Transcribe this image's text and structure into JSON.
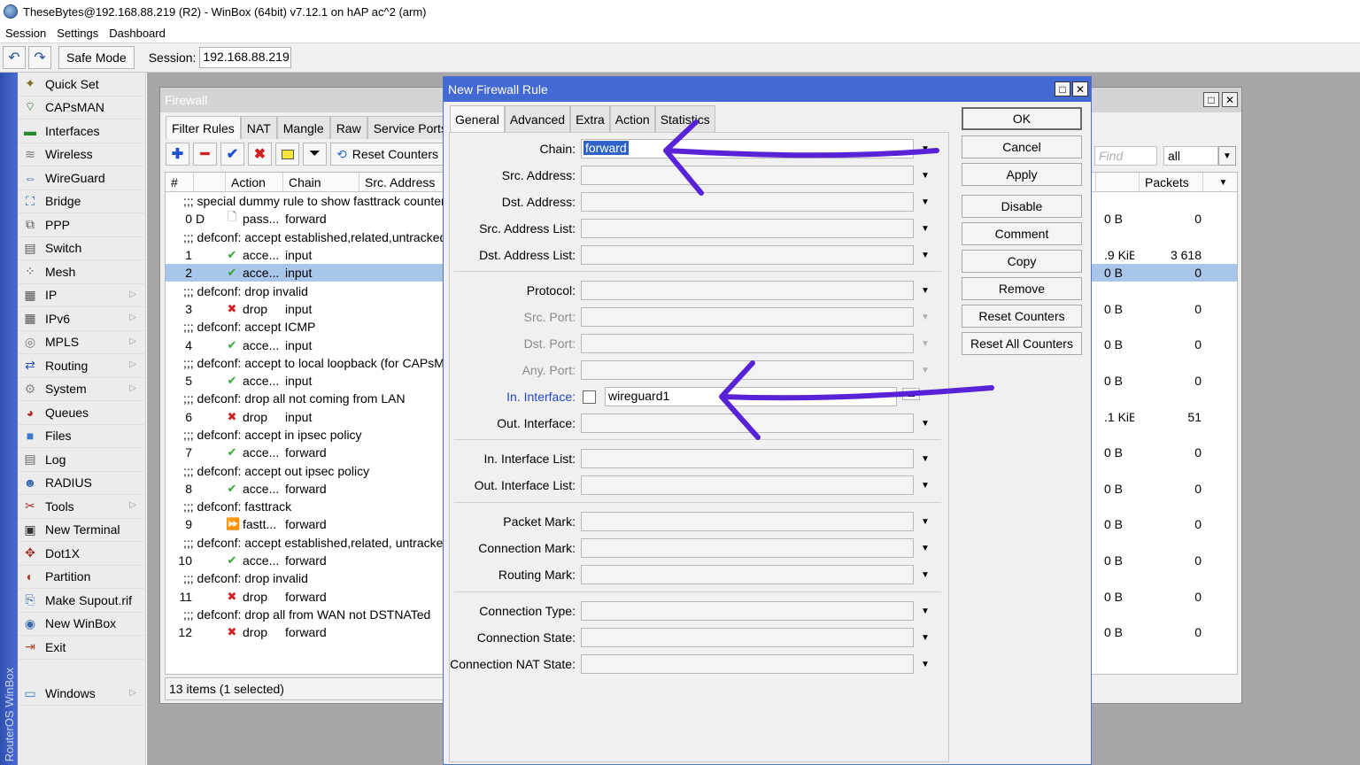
{
  "window_title": "TheseBytes@192.168.88.219 (R2) - WinBox (64bit) v7.12.1 on hAP ac^2 (arm)",
  "menu": [
    "Session",
    "Settings",
    "Dashboard"
  ],
  "toolbar": {
    "safe_mode": "Safe Mode",
    "session_label": "Session:",
    "session_value": "192.168.88.219"
  },
  "vertical_brand": "RouterOS WinBox",
  "sidebar": [
    {
      "label": "Quick Set",
      "icon": "wand-icon",
      "sub": false
    },
    {
      "label": "CAPsMAN",
      "icon": "antenna-icon",
      "sub": false
    },
    {
      "label": "Interfaces",
      "icon": "network-card-icon",
      "sub": false
    },
    {
      "label": "Wireless",
      "icon": "wifi-icon",
      "sub": false
    },
    {
      "label": "WireGuard",
      "icon": "wireguard-icon",
      "sub": false
    },
    {
      "label": "Bridge",
      "icon": "bridge-icon",
      "sub": false
    },
    {
      "label": "PPP",
      "icon": "ppp-icon",
      "sub": false
    },
    {
      "label": "Switch",
      "icon": "switch-icon",
      "sub": false
    },
    {
      "label": "Mesh",
      "icon": "mesh-icon",
      "sub": false
    },
    {
      "label": "IP",
      "icon": "ip-icon",
      "sub": true
    },
    {
      "label": "IPv6",
      "icon": "ipv6-icon",
      "sub": true
    },
    {
      "label": "MPLS",
      "icon": "mpls-icon",
      "sub": true
    },
    {
      "label": "Routing",
      "icon": "routing-icon",
      "sub": true
    },
    {
      "label": "System",
      "icon": "gear-icon",
      "sub": true
    },
    {
      "label": "Queues",
      "icon": "queues-icon",
      "sub": false
    },
    {
      "label": "Files",
      "icon": "folder-icon",
      "sub": false
    },
    {
      "label": "Log",
      "icon": "log-icon",
      "sub": false
    },
    {
      "label": "RADIUS",
      "icon": "users-icon",
      "sub": false
    },
    {
      "label": "Tools",
      "icon": "tools-icon",
      "sub": true
    },
    {
      "label": "New Terminal",
      "icon": "terminal-icon",
      "sub": false
    },
    {
      "label": "Dot1X",
      "icon": "dot1x-icon",
      "sub": false
    },
    {
      "label": "Partition",
      "icon": "partition-icon",
      "sub": false
    },
    {
      "label": "Make Supout.rif",
      "icon": "supout-icon",
      "sub": false
    },
    {
      "label": "New WinBox",
      "icon": "winbox-icon",
      "sub": false
    },
    {
      "label": "Exit",
      "icon": "exit-icon",
      "sub": false
    }
  ],
  "sidebar_windows": "Windows",
  "firewall": {
    "title": "Firewall",
    "tabs": [
      "Filter Rules",
      "NAT",
      "Mangle",
      "Raw",
      "Service Ports"
    ],
    "reset_counters": "Reset Counters",
    "find_placeholder": "Find",
    "filter_value": "all",
    "columns": {
      "num": "#",
      "action": "Action",
      "chain": "Chain",
      "src": "Src. Address",
      "packets": "Packets"
    },
    "rows": [
      {
        "type": "comment",
        "text": ";;; special dummy rule to show fasttrack counters"
      },
      {
        "type": "rule",
        "num": "0",
        "flag": "D",
        "icon": "pass",
        "action": "pass...",
        "chain": "forward",
        "bytes": "0 B",
        "packets": "0"
      },
      {
        "type": "comment",
        "text": ";;; defconf: accept established,related,untracked"
      },
      {
        "type": "rule",
        "num": "1",
        "flag": "",
        "icon": "accept",
        "action": "acce...",
        "chain": "input",
        "bytes": ".9 KiB",
        "packets": "3 618"
      },
      {
        "type": "rule",
        "num": "2",
        "flag": "",
        "icon": "accept",
        "action": "acce...",
        "chain": "input",
        "bytes": "0 B",
        "packets": "0",
        "selected": true
      },
      {
        "type": "comment",
        "text": ";;; defconf: drop invalid"
      },
      {
        "type": "rule",
        "num": "3",
        "flag": "",
        "icon": "drop",
        "action": "drop",
        "chain": "input",
        "bytes": "0 B",
        "packets": "0"
      },
      {
        "type": "comment",
        "text": ";;; defconf: accept ICMP"
      },
      {
        "type": "rule",
        "num": "4",
        "flag": "",
        "icon": "accept",
        "action": "acce...",
        "chain": "input",
        "bytes": "0 B",
        "packets": "0"
      },
      {
        "type": "comment",
        "text": ";;; defconf: accept to local loopback (for CAPsMAN)"
      },
      {
        "type": "rule",
        "num": "5",
        "flag": "",
        "icon": "accept",
        "action": "acce...",
        "chain": "input",
        "bytes": "0 B",
        "packets": "0"
      },
      {
        "type": "comment",
        "text": ";;; defconf: drop all not coming from LAN"
      },
      {
        "type": "rule",
        "num": "6",
        "flag": "",
        "icon": "drop",
        "action": "drop",
        "chain": "input",
        "bytes": ".1 KiB",
        "packets": "51"
      },
      {
        "type": "comment",
        "text": ";;; defconf: accept in ipsec policy"
      },
      {
        "type": "rule",
        "num": "7",
        "flag": "",
        "icon": "accept",
        "action": "acce...",
        "chain": "forward",
        "bytes": "0 B",
        "packets": "0"
      },
      {
        "type": "comment",
        "text": ";;; defconf: accept out ipsec policy"
      },
      {
        "type": "rule",
        "num": "8",
        "flag": "",
        "icon": "accept",
        "action": "acce...",
        "chain": "forward",
        "bytes": "0 B",
        "packets": "0"
      },
      {
        "type": "comment",
        "text": ";;; defconf: fasttrack"
      },
      {
        "type": "rule",
        "num": "9",
        "flag": "",
        "icon": "fasttrack",
        "action": "fastt...",
        "chain": "forward",
        "bytes": "0 B",
        "packets": "0"
      },
      {
        "type": "comment",
        "text": ";;; defconf: accept established,related, untracked"
      },
      {
        "type": "rule",
        "num": "10",
        "flag": "",
        "icon": "accept",
        "action": "acce...",
        "chain": "forward",
        "bytes": "0 B",
        "packets": "0"
      },
      {
        "type": "comment",
        "text": ";;; defconf: drop invalid"
      },
      {
        "type": "rule",
        "num": "11",
        "flag": "",
        "icon": "drop",
        "action": "drop",
        "chain": "forward",
        "bytes": "0 B",
        "packets": "0"
      },
      {
        "type": "comment",
        "text": ";;; defconf: drop all from WAN not DSTNATed"
      },
      {
        "type": "rule",
        "num": "12",
        "flag": "",
        "icon": "drop",
        "action": "drop",
        "chain": "forward",
        "bytes": "0 B",
        "packets": "0"
      }
    ],
    "status": "13 items (1 selected)"
  },
  "dialog": {
    "title": "New Firewall Rule",
    "tabs": [
      "General",
      "Advanced",
      "Extra",
      "Action",
      "Statistics"
    ],
    "fields": {
      "chain": {
        "label": "Chain:",
        "value": "forward"
      },
      "src_address": {
        "label": "Src. Address:"
      },
      "dst_address": {
        "label": "Dst. Address:"
      },
      "src_address_list": {
        "label": "Src. Address List:"
      },
      "dst_address_list": {
        "label": "Dst. Address List:"
      },
      "protocol": {
        "label": "Protocol:"
      },
      "src_port": {
        "label": "Src. Port:"
      },
      "dst_port": {
        "label": "Dst. Port:"
      },
      "any_port": {
        "label": "Any. Port:"
      },
      "in_interface": {
        "label": "In. Interface:",
        "value": "wireguard1"
      },
      "out_interface": {
        "label": "Out. Interface:"
      },
      "in_interface_list": {
        "label": "In. Interface List:"
      },
      "out_interface_list": {
        "label": "Out. Interface List:"
      },
      "packet_mark": {
        "label": "Packet Mark:"
      },
      "connection_mark": {
        "label": "Connection Mark:"
      },
      "routing_mark": {
        "label": "Routing Mark:"
      },
      "connection_type": {
        "label": "Connection Type:"
      },
      "connection_state": {
        "label": "Connection State:"
      },
      "connection_nat_state": {
        "label": "Connection NAT State:"
      }
    },
    "buttons": {
      "ok": "OK",
      "cancel": "Cancel",
      "apply": "Apply",
      "disable": "Disable",
      "comment": "Comment",
      "copy": "Copy",
      "remove": "Remove",
      "reset_counters": "Reset Counters",
      "reset_all_counters": "Reset All Counters"
    }
  },
  "colors": {
    "dialog_title": "#4269d4",
    "selection": "#a8c6ea",
    "annotation_arrow": "#5a22d6",
    "accept": "#2fa82f",
    "drop": "#d02020"
  }
}
